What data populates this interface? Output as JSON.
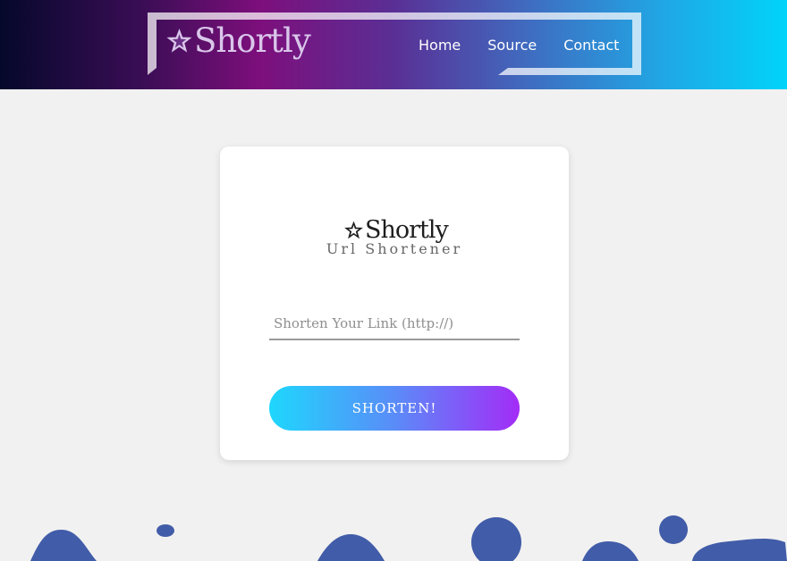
{
  "header": {
    "brand_text": "Shortly",
    "nav": [
      {
        "label": "Home"
      },
      {
        "label": "Source"
      },
      {
        "label": "Contact"
      }
    ]
  },
  "card": {
    "logo_text": "Shortly",
    "subtitle": "Url Shortener",
    "input": {
      "placeholder": "Shorten Your Link (http://)",
      "value": ""
    },
    "submit_label": "SHORTEN!"
  },
  "colors": {
    "accent_start": "#1ed7fd",
    "accent_end": "#a32cf7",
    "blob": "#415ca8",
    "background": "#f1f1f1"
  },
  "icons": {
    "brand": "star-outline-icon"
  }
}
